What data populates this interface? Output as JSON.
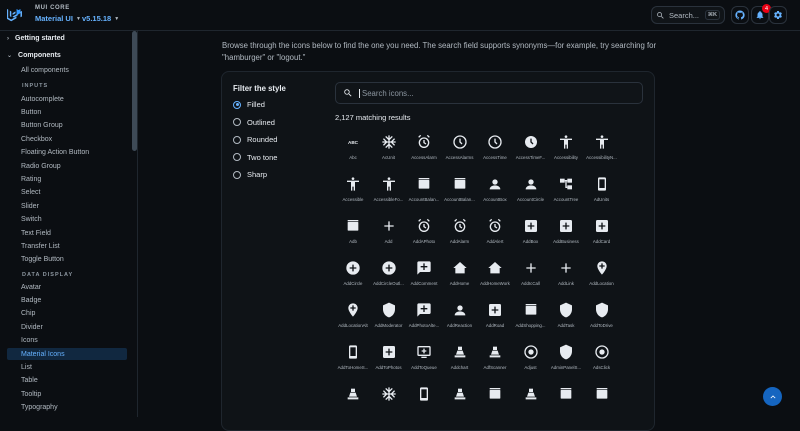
{
  "header": {
    "brand": "MUI CORE",
    "product": "Material UI",
    "version": "v5.15.18",
    "search_label": "Search...",
    "search_shortcut": "⌘K",
    "notification_count": "4"
  },
  "sidebar": {
    "getting_started": "Getting started",
    "components": "Components",
    "all_components": "All components",
    "inputs_section": "INPUTS",
    "inputs": [
      "Autocomplete",
      "Button",
      "Button Group",
      "Checkbox",
      "Floating Action Button",
      "Radio Group",
      "Rating",
      "Select",
      "Slider",
      "Switch",
      "Text Field",
      "Transfer List",
      "Toggle Button"
    ],
    "data_display_section": "DATA DISPLAY",
    "data_display": [
      "Avatar",
      "Badge",
      "Chip",
      "Divider",
      "Icons",
      "Material Icons",
      "List",
      "Table",
      "Tooltip",
      "Typography"
    ],
    "active_item": "Material Icons"
  },
  "main": {
    "intro": "Browse through the icons below to find the one you need. The search field supports synonyms—for example, try searching for \"hamburger\" or \"logout.\"",
    "filter_title": "Filter the style",
    "styles": [
      "Filled",
      "Outlined",
      "Rounded",
      "Two tone",
      "Sharp"
    ],
    "selected_style": "Filled",
    "search_placeholder": "Search icons...",
    "results": "2,127 matching results",
    "icons": [
      "Abc",
      "AcUnit",
      "AccessAlarm",
      "AccessAlarms",
      "AccessTime",
      "AccessTimeF...",
      "Accessibility",
      "AccessibilityN...",
      "Accessible",
      "AccessibleFo...",
      "AccountBalan...",
      "AccountBalan...",
      "AccountBox",
      "AccountCircle",
      "AccountTree",
      "AdUnits",
      "Adb",
      "Add",
      "AddAPhoto",
      "AddAlarm",
      "AddAlert",
      "AddBox",
      "AddBusiness",
      "AddCard",
      "AddCircle",
      "AddCircleOutl...",
      "AddComment",
      "AddHome",
      "AddHomeWork",
      "AddIcCall",
      "AddLink",
      "AddLocation",
      "AddLocationAlt",
      "AddModerator",
      "AddPhotoAlte...",
      "AddReaction",
      "AddRoad",
      "AddShopping...",
      "AddTask",
      "AddToDrive",
      "AddToHomeS...",
      "AddToPhotos",
      "AddToQueue",
      "Addchart",
      "AdfScanner",
      "Adjust",
      "AdminPanelS...",
      "AdsClick"
    ]
  }
}
